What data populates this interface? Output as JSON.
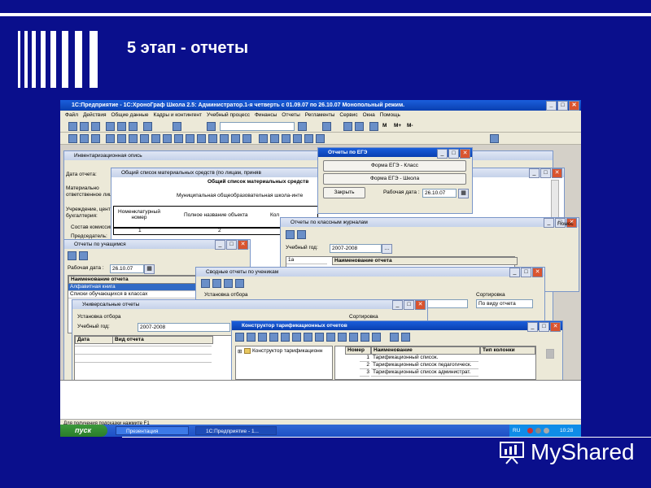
{
  "slide": {
    "title": "5 этап - отчеты",
    "logo_text": "MyShared"
  },
  "app": {
    "title": "1С:Предприятие - 1С:ХроноГраф Школа 2.5: Администратор.1-я четверть с 01.09.07 по 26.10.07 Монопольный режим.",
    "menu": [
      "Файл",
      "Действия",
      "Общие данные",
      "Кадры и контингент",
      "Учебный процесс",
      "Финансы",
      "Отчеты",
      "Регламенты",
      "Сервис",
      "Окна",
      "Помощь"
    ],
    "toolbar_labels": {
      "m": "М",
      "mplus": "М+",
      "mminus": "М-"
    }
  },
  "windows": {
    "inventory": {
      "title": "Инвентаризационная опись",
      "labels": [
        "Дата отчета:",
        "Материально",
        "ответственное лиц",
        "Учреждение, центр",
        "бухгалтерия:",
        "Состав комиссии",
        "Председатель:"
      ]
    },
    "assets_list": {
      "title": "Общий список материальных средств (по лицам, приняв",
      "header": "Общий список материальных средств",
      "subheader": "Муниципальная общеобразовательная школа-инте",
      "col1": "Номенклатурный номер",
      "col2": "Полное название объекта",
      "col3": "Кол",
      "num1": "1",
      "num2": "2"
    },
    "ege": {
      "title": "Отчеты по ЕГЭ",
      "btn_class": "Форма ЕГЭ - Класс",
      "btn_school": "Форма ЕГЭ - Школа",
      "btn_close": "Закрыть",
      "date_label": "Рабочая дата :",
      "date_value": "26.10.07"
    },
    "class_journals": {
      "title": "Отчеты по классным журналам",
      "year_label": "Учебный год:",
      "year_value": "2007-2008",
      "col_name": "Наименование отчета",
      "class_cell": "1а",
      "right_text": "Помос"
    },
    "students": {
      "title": "Отчеты по учащимся",
      "date_label": "Рабочая дата :",
      "date_value": "26.10.07",
      "col": "Наименование отчета",
      "rows": [
        "Алфавитная книга",
        "Списки обучающихся в классах"
      ]
    },
    "summary": {
      "title": "Сводные отчеты по ученикам",
      "filter_label": "Установка отбора",
      "sort_label": "Сортировка",
      "sort_value": "По виду отчета"
    },
    "universal": {
      "title": "Универсальные отчеты",
      "filter_label": "Установка отбора",
      "year_label": "Учебный год:",
      "year_value": "2007-2008",
      "sort_label": "Сортировка",
      "col_date": "Дата",
      "col_type": "Вид отчета"
    },
    "tariff": {
      "title": "Конструктор тарификационных отчетов",
      "tree_root": "Конструктор тарификационн",
      "col_num": "Номер",
      "col_name": "Наименование",
      "col_type": "Тип колонки",
      "rows": [
        {
          "num": "1",
          "name": "Тарификационный список."
        },
        {
          "num": "2",
          "name": "Тарификационный список педагогическ."
        },
        {
          "num": "3",
          "name": "Тарификационный список администрат."
        }
      ]
    }
  },
  "statusbar": {
    "text": "Для получения подсказки нажмите F1"
  },
  "taskbar": {
    "start": "пуск",
    "tasks": [
      "Презентация",
      "1С:Предприятие - 1..."
    ],
    "lang": "RU",
    "clock": "10:28"
  }
}
